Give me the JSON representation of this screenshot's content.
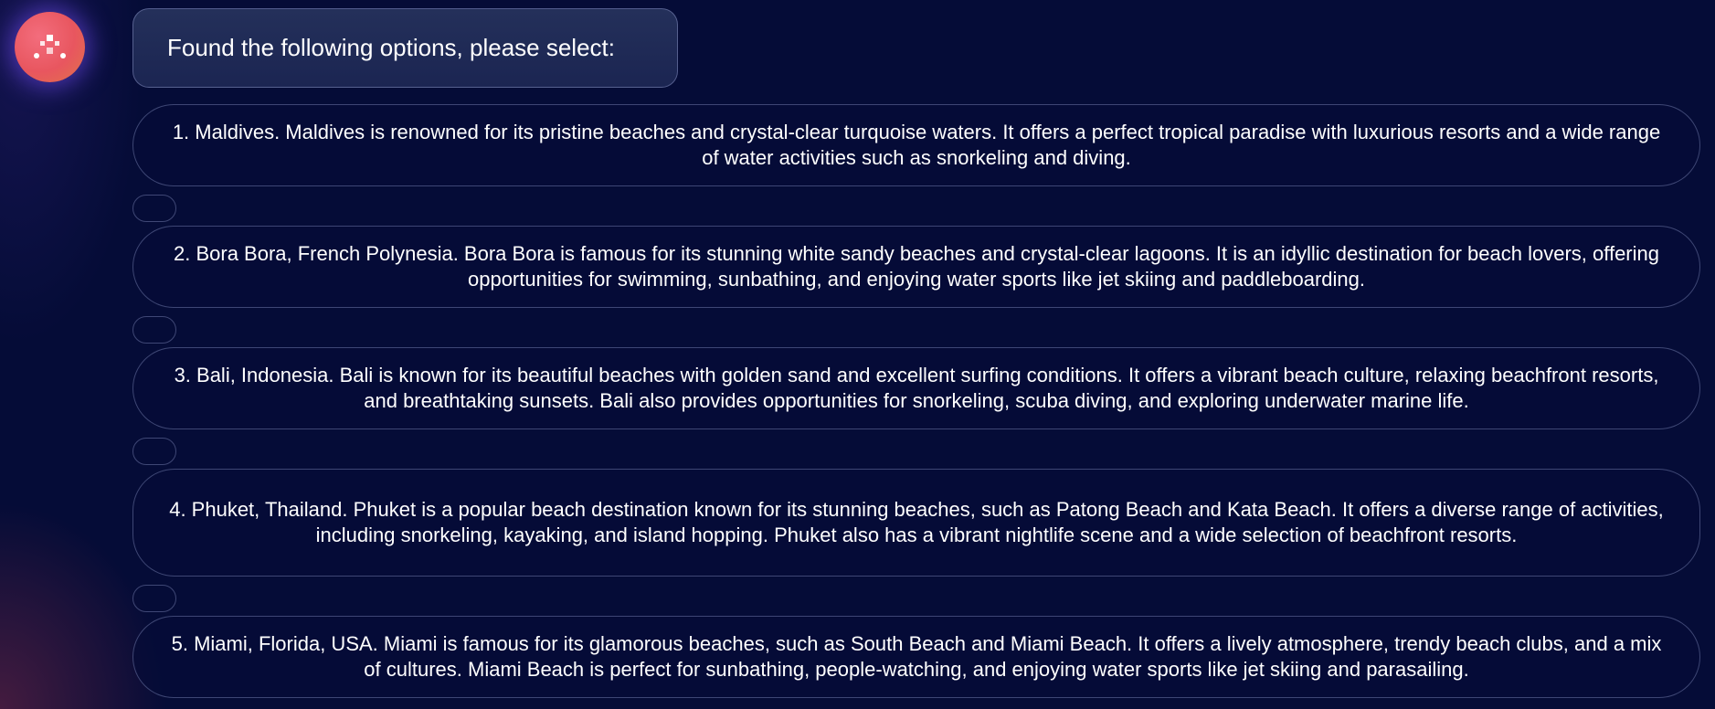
{
  "assistant": {
    "avatar_icon": "assistant-logo-icon",
    "accent_color": "#e8565f"
  },
  "message": {
    "header": "Found the following options, please select:"
  },
  "options": [
    {
      "text": "1. Maldives. Maldives is renowned for its pristine beaches and crystal-clear turquoise waters. It offers a perfect tropical paradise with luxurious resorts and a wide range of water activities such as snorkeling and diving."
    },
    {
      "text": "2. Bora Bora, French Polynesia. Bora Bora is famous for its stunning white sandy beaches and crystal-clear lagoons. It is an idyllic destination for beach lovers, offering opportunities for swimming, sunbathing, and enjoying water sports like jet skiing and paddleboarding."
    },
    {
      "text": "3. Bali, Indonesia. Bali is known for its beautiful beaches with golden sand and excellent surfing conditions. It offers a vibrant beach culture, relaxing beachfront resorts, and breathtaking sunsets. Bali also provides opportunities for snorkeling, scuba diving, and exploring underwater marine life."
    },
    {
      "text": "4. Phuket, Thailand. Phuket is a popular beach destination known for its stunning beaches, such as Patong Beach and Kata Beach. It offers a diverse range of activities, including snorkeling, kayaking, and island hopping. Phuket also has a vibrant nightlife scene and a wide selection of beachfront resorts."
    },
    {
      "text": "5. Miami, Florida, USA. Miami is famous for its glamorous beaches, such as South Beach and Miami Beach. It offers a lively atmosphere, trendy beach clubs, and a mix of cultures. Miami Beach is perfect for sunbathing, people-watching, and enjoying water sports like jet skiing and parasailing."
    }
  ]
}
